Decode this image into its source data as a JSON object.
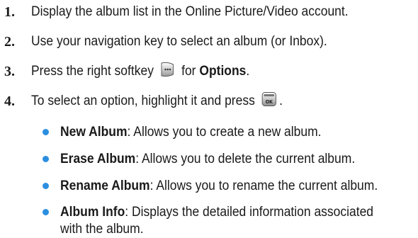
{
  "steps": [
    {
      "number": "1.",
      "text": "Display the album list in the Online Picture/Video account."
    },
    {
      "number": "2.",
      "text": "Use your navigation key to select an album (or Inbox)."
    },
    {
      "number": "3.",
      "text_before": "Press the right softkey",
      "text_middle": "for",
      "keyword": "Options",
      "text_after": "."
    },
    {
      "number": "4.",
      "text_before": "To select an option, highlight it and press",
      "text_after": "."
    }
  ],
  "icons": {
    "softkey": "right-softkey-icon",
    "ok": "ok-key-icon",
    "ok_label": "OK",
    "bullet_color": "#2b8fe0"
  },
  "options": [
    {
      "term": "New Album",
      "description": ": Allows you to create a new album."
    },
    {
      "term": "Erase Album",
      "description": ": Allows you to delete the current album."
    },
    {
      "term": "Rename Album",
      "description": ": Allows you to rename the current album."
    },
    {
      "term": "Album Info",
      "description": ": Displays the detailed information associated with the album."
    }
  ]
}
